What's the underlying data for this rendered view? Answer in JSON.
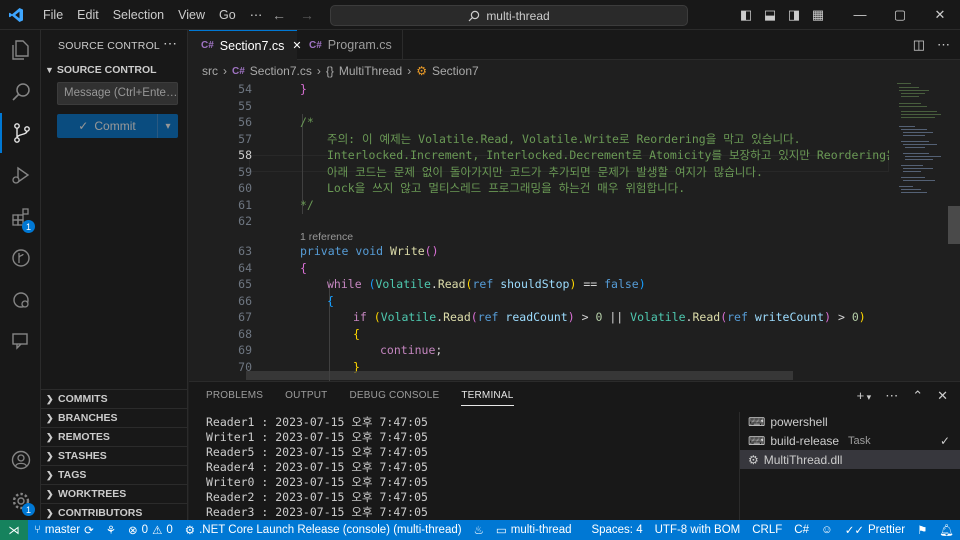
{
  "titlebar": {
    "menu": [
      "File",
      "Edit",
      "Selection",
      "View",
      "Go",
      "⋯"
    ],
    "search": "multi-thread"
  },
  "activity": {
    "extensions_badge": "1"
  },
  "sidebar": {
    "title": "SOURCE CONTROL",
    "section": "SOURCE CONTROL",
    "message_placeholder": "Message (Ctrl+Ente…",
    "commit_label": "Commit",
    "sections": [
      "COMMITS",
      "BRANCHES",
      "REMOTES",
      "STASHES",
      "TAGS",
      "WORKTREES",
      "CONTRIBUTORS"
    ]
  },
  "tabs": [
    {
      "label": "Section7.cs",
      "icon": "C#"
    },
    {
      "label": "Program.cs",
      "icon": "C#"
    }
  ],
  "breadcrumb": {
    "folder": "src",
    "file": "Section7.cs",
    "ns": "MultiThread",
    "cls": "Section7"
  },
  "editor": {
    "line_numbers": [
      "54",
      "55",
      "56",
      "57",
      "58",
      "59",
      "60",
      "61",
      "62",
      "63",
      "64",
      "65",
      "66",
      "67",
      "68",
      "69",
      "70"
    ],
    "codelens": "1 reference",
    "comment_lines": [
      "주의: 이 예제는 Volatile.Read, Volatile.Write로 Reordering을 막고 있습니다.",
      "Interlocked.Increment, Interlocked.Decrement로 Atomicity를 보장하고 있지만 Reordering은",
      "아래 코드는 문제 없이 돌아가지만 코드가 추가되면 문제가 발생할 여지가 많습니다.",
      "Lock을 쓰지 않고 멀티스레드 프로그래밍을 하는건 매우 위험합니다."
    ]
  },
  "panel": {
    "tabs": [
      "PROBLEMS",
      "OUTPUT",
      "DEBUG CONSOLE",
      "TERMINAL"
    ],
    "terminal_lines": [
      "Reader1 : 2023-07-15 오후 7:47:05",
      "Writer1 : 2023-07-15 오후 7:47:05",
      "Reader5 : 2023-07-15 오후 7:47:05",
      "Reader4 : 2023-07-15 오후 7:47:05",
      "Writer0 : 2023-07-15 오후 7:47:05",
      "Reader2 : 2023-07-15 오후 7:47:05",
      "Reader3 : 2023-07-15 오후 7:47:05"
    ],
    "terminals": [
      {
        "name": "powershell",
        "tag": ""
      },
      {
        "name": "build-release",
        "tag": "Task"
      },
      {
        "name": "MultiThread.dll",
        "tag": ""
      }
    ]
  },
  "statusbar": {
    "branch": "master",
    "errors": "0",
    "warnings": "0",
    "launch": ".NET Core Launch Release (console) (multi-thread)",
    "project": "multi-thread",
    "spaces": "Spaces: 4",
    "encoding": "UTF-8 with BOM",
    "eol": "CRLF",
    "language": "C#",
    "formatter": "Prettier"
  },
  "colors": {
    "accent": "#0078d4",
    "remote": "#16825d",
    "comment": "#6a9955",
    "keyword": "#569cd6"
  }
}
